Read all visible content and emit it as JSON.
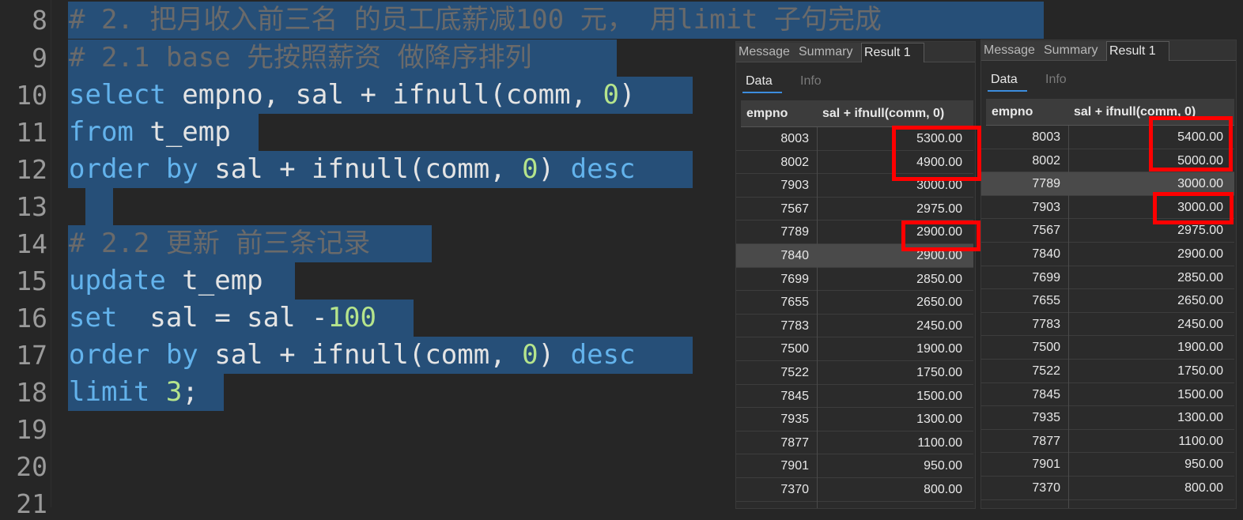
{
  "editor": {
    "line_numbers": [
      "8",
      "9",
      "10",
      "11",
      "12",
      "13",
      "14",
      "15",
      "16",
      "17",
      "18",
      "19",
      "20",
      "21"
    ],
    "lines": [
      [
        {
          "c": "cm",
          "t": "# 2. 把月收入前三名 的员工底薪减100 元， 用limit 子句完成"
        }
      ],
      [
        {
          "c": "cm",
          "t": "# 2.1 base 先按照薪资 做降序排列"
        }
      ],
      [
        {
          "c": "kw",
          "t": "select"
        },
        {
          "c": "tx",
          "t": " empno, sal + ifnull(comm, "
        },
        {
          "c": "num",
          "t": "0"
        },
        {
          "c": "tx",
          "t": ")"
        }
      ],
      [
        {
          "c": "kw",
          "t": "from"
        },
        {
          "c": "tx",
          "t": " t_emp"
        }
      ],
      [
        {
          "c": "kw",
          "t": "order by"
        },
        {
          "c": "tx",
          "t": " sal + ifnull(comm, "
        },
        {
          "c": "num",
          "t": "0"
        },
        {
          "c": "tx",
          "t": ") "
        },
        {
          "c": "kw",
          "t": "desc"
        }
      ],
      [
        {
          "c": "tx",
          "t": ""
        }
      ],
      [
        {
          "c": "cm",
          "t": "# 2.2 更新 前三条记录"
        }
      ],
      [
        {
          "c": "kw",
          "t": "update"
        },
        {
          "c": "tx",
          "t": " t_emp"
        }
      ],
      [
        {
          "c": "kw",
          "t": "set"
        },
        {
          "c": "tx",
          "t": "  sal = sal -"
        },
        {
          "c": "num",
          "t": "100"
        }
      ],
      [
        {
          "c": "kw",
          "t": "order by"
        },
        {
          "c": "tx",
          "t": " sal + ifnull(comm, "
        },
        {
          "c": "num",
          "t": "0"
        },
        {
          "c": "tx",
          "t": ") "
        },
        {
          "c": "kw",
          "t": "desc"
        }
      ],
      [
        {
          "c": "kw",
          "t": "limit"
        },
        {
          "c": "tx",
          "t": " "
        },
        {
          "c": "num",
          "t": "3"
        },
        {
          "c": "tx",
          "t": ";"
        }
      ],
      [
        {
          "c": "tx",
          "t": ""
        }
      ],
      [
        {
          "c": "tx",
          "t": ""
        }
      ],
      [
        {
          "c": "tx",
          "t": ""
        }
      ]
    ]
  },
  "panels": [
    {
      "tabs": [
        "Message",
        "Summary",
        "Result 1"
      ],
      "active_tab": 2,
      "subtabs": [
        "Data",
        "Info"
      ],
      "columns": [
        "empno",
        "sal + ifnull(comm, 0)"
      ],
      "rows": [
        [
          "8003",
          "5300.00"
        ],
        [
          "8002",
          "4900.00"
        ],
        [
          "7903",
          "3000.00"
        ],
        [
          "7567",
          "2975.00"
        ],
        [
          "7789",
          "2900.00"
        ],
        [
          "7840",
          "2900.00"
        ],
        [
          "7699",
          "2850.00"
        ],
        [
          "7655",
          "2650.00"
        ],
        [
          "7783",
          "2450.00"
        ],
        [
          "7500",
          "1900.00"
        ],
        [
          "7522",
          "1750.00"
        ],
        [
          "7845",
          "1500.00"
        ],
        [
          "7935",
          "1300.00"
        ],
        [
          "7877",
          "1100.00"
        ],
        [
          "7901",
          "950.00"
        ],
        [
          "7370",
          "800.00"
        ]
      ],
      "highlighted_row": 5
    },
    {
      "tabs": [
        "Message",
        "Summary",
        "Result 1"
      ],
      "active_tab": 2,
      "subtabs": [
        "Data",
        "Info"
      ],
      "columns": [
        "empno",
        "sal + ifnull(comm, 0)"
      ],
      "rows": [
        [
          "8003",
          "5400.00"
        ],
        [
          "8002",
          "5000.00"
        ],
        [
          "7789",
          "3000.00"
        ],
        [
          "7903",
          "3000.00"
        ],
        [
          "7567",
          "2975.00"
        ],
        [
          "7840",
          "2900.00"
        ],
        [
          "7699",
          "2850.00"
        ],
        [
          "7655",
          "2650.00"
        ],
        [
          "7783",
          "2450.00"
        ],
        [
          "7500",
          "1900.00"
        ],
        [
          "7522",
          "1750.00"
        ],
        [
          "7845",
          "1500.00"
        ],
        [
          "7935",
          "1300.00"
        ],
        [
          "7877",
          "1100.00"
        ],
        [
          "7901",
          "950.00"
        ],
        [
          "7370",
          "800.00"
        ]
      ],
      "highlighted_row": 2
    }
  ],
  "colors": {
    "annotation": "#ff0000",
    "selection": "#264f78"
  }
}
